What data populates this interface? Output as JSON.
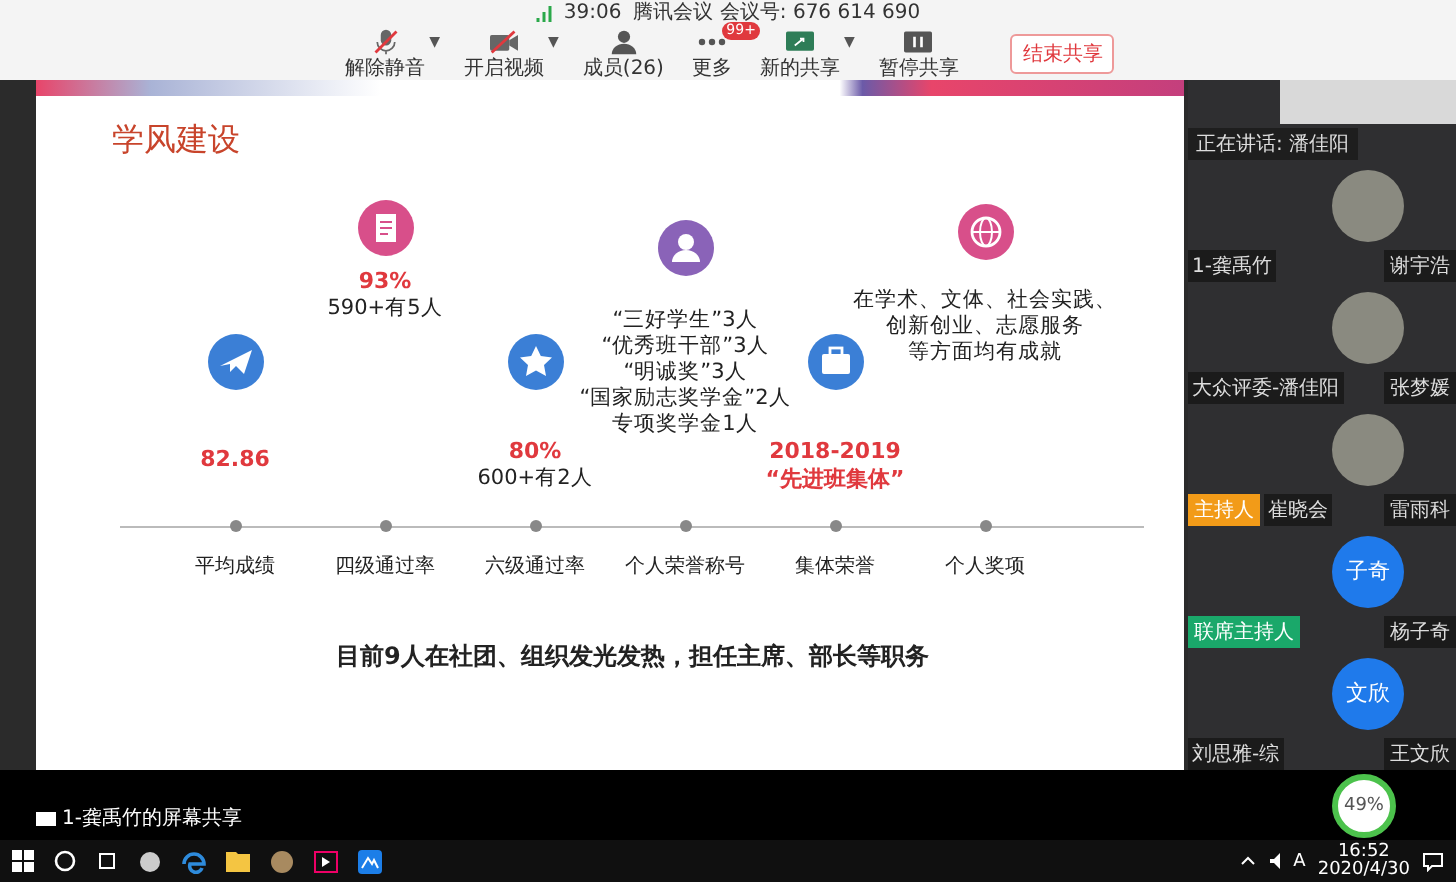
{
  "meeting_bar": {
    "timer": "39:06",
    "info": "腾讯会议 会议号: 676 614 690",
    "tools": [
      {
        "kind": "mic",
        "label": "解除静音",
        "caret": "▼"
      },
      {
        "kind": "camera",
        "label": "开启视频",
        "caret": "▼"
      },
      {
        "kind": "members",
        "label": "成员(26)"
      },
      {
        "kind": "more",
        "label": "更多",
        "badge": "99+"
      },
      {
        "kind": "share",
        "label": "新的共享",
        "caret": "▼"
      },
      {
        "kind": "pause",
        "label": "暂停共享"
      }
    ],
    "end_button": "结束共享"
  },
  "slide": {
    "title": "学风建设",
    "columns": [
      {
        "color": "#3b7fd6",
        "lines": [
          {
            "text": "82.86",
            "kind": "value"
          }
        ],
        "label": "平均成绩"
      },
      {
        "color": "#d84f8a",
        "lines": [
          {
            "text": "93%",
            "kind": "value"
          },
          {
            "text": "590+有5人",
            "kind": "note"
          }
        ],
        "label": "四级通过率"
      },
      {
        "color": "#3b7fd6",
        "lines": [
          {
            "text": "80%",
            "kind": "value"
          },
          {
            "text": "600+有2人",
            "kind": "note"
          }
        ],
        "label": "六级通过率"
      },
      {
        "color": "#8a63b8",
        "lines": [
          {
            "text": "“三好学生”3人",
            "kind": "note"
          },
          {
            "text": "“优秀班干部”3人",
            "kind": "note"
          },
          {
            "text": "“明诚奖”3人",
            "kind": "note"
          },
          {
            "text": "“国家励志奖学金”2人",
            "kind": "note"
          },
          {
            "text": "专项奖学金1人",
            "kind": "note"
          }
        ],
        "label": "个人荣誉称号"
      },
      {
        "color": "#3b7fd6",
        "lines": [
          {
            "text": "2018-2019",
            "kind": "value"
          },
          {
            "text": "“先进班集体”",
            "kind": "value"
          }
        ],
        "label": "集体荣誉"
      },
      {
        "color": "#d84f8a",
        "lines": [
          {
            "text": "在学术、文体、社会实践、",
            "kind": "note"
          },
          {
            "text": "创新创业、志愿服务",
            "kind": "note"
          },
          {
            "text": "等方面均有成就",
            "kind": "note"
          }
        ],
        "label": "个人奖项"
      }
    ],
    "footer": "目前9人在社团、组织发光发热，担任主席、部长等职务"
  },
  "participants": {
    "speaking": "正在讲话: 潘佳阳",
    "tiles": [
      {
        "side_label": "1-龚禹竹",
        "name": "谢宇浩"
      },
      {
        "side_label": "大众评委-潘佳阳",
        "name": "张梦媛"
      },
      {
        "role": {
          "text": "主持人",
          "color": "#f29b18"
        },
        "side_label": "崔晓会",
        "name": "雷雨科"
      },
      {
        "role": {
          "text": "联席主持人",
          "color": "#1aa86a"
        },
        "avatar_text": "子奇",
        "name": "杨子奇"
      },
      {
        "side_label": "刘思雅-综",
        "avatar_text": "文欣",
        "name": "王文欣"
      }
    ],
    "network": "49%"
  },
  "share_label": "1-龚禹竹的屏幕共享",
  "taskbar": {
    "time": "16:52",
    "date": "2020/4/30",
    "ime": "A"
  }
}
